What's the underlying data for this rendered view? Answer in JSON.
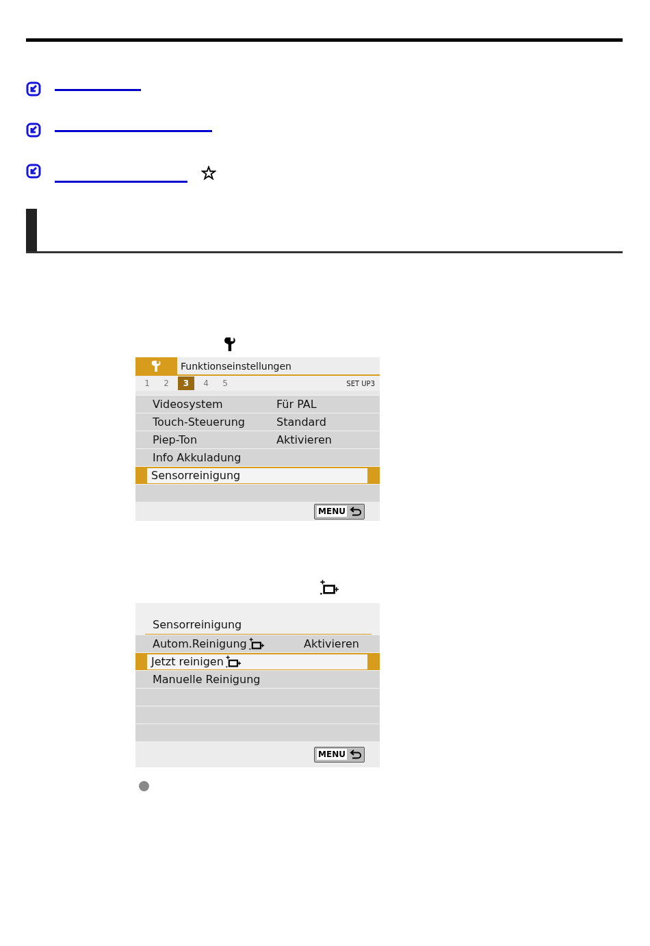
{
  "links": [
    {
      "kind": "plain"
    },
    {
      "kind": "plain"
    },
    {
      "kind": "starred"
    }
  ],
  "menu_screens": [
    {
      "kind": "tabbed",
      "title": "Funktionseinstellungen",
      "tabs": [
        {
          "label": "1",
          "selected": false
        },
        {
          "label": "2",
          "selected": false
        },
        {
          "label": "3",
          "selected": true
        },
        {
          "label": "4",
          "selected": false
        },
        {
          "label": "5",
          "selected": false
        }
      ],
      "page_label": "SET UP3",
      "items": [
        {
          "kind": "entry",
          "label": "Videosystem",
          "value": "Für PAL",
          "selected": false
        },
        {
          "kind": "entry",
          "label": "Touch-Steuerung",
          "value": "Standard",
          "selected": false
        },
        {
          "kind": "entry",
          "label": "Piep-Ton",
          "value": "Aktivieren",
          "selected": false
        },
        {
          "kind": "entry",
          "label": "Info Akkuladung",
          "selected": false
        },
        {
          "kind": "entry",
          "label": "Sensorreinigung",
          "selected": true
        },
        {
          "kind": "blank"
        }
      ],
      "footer_button": "MENU"
    },
    {
      "kind": "titled",
      "title": "Sensorreinigung",
      "items": [
        {
          "kind": "entry_icon",
          "label": "Autom.Reinigung",
          "value": "Aktivieren",
          "selected": false
        },
        {
          "kind": "entry_icon",
          "label": "Jetzt reinigen",
          "selected": true
        },
        {
          "kind": "entry",
          "label": "Manuelle Reinigung",
          "selected": false
        },
        {
          "kind": "blank"
        },
        {
          "kind": "blank"
        },
        {
          "kind": "blank"
        }
      ],
      "footer_button": "MENU"
    }
  ]
}
